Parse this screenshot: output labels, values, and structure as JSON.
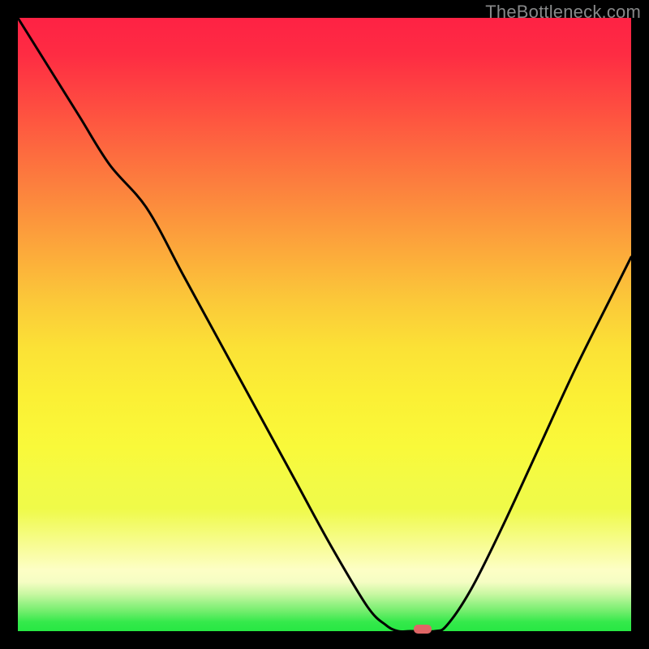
{
  "watermark": "TheBottleneck.com",
  "colors": {
    "gradient_top": "#fe2244",
    "gradient_mid": "#fbe236",
    "gradient_bottom": "#27e743",
    "curve_stroke": "#000000",
    "marker_fill": "#e06666",
    "frame_bg": "#000000"
  },
  "chart_data": {
    "type": "line",
    "title": "",
    "xlabel": "",
    "ylabel": "",
    "xlim": [
      0,
      100
    ],
    "ylim": [
      0,
      100
    ],
    "grid": false,
    "legend": false,
    "annotations": [
      {
        "kind": "marker",
        "x": 66,
        "y": 0,
        "shape": "rounded-rect",
        "color": "#e06666"
      }
    ],
    "series": [
      {
        "name": "bottleneck-curve",
        "color": "#000000",
        "x": [
          0,
          5,
          10,
          15,
          21,
          27,
          33,
          39,
          45,
          51,
          57,
          60,
          62,
          64,
          68,
          70,
          74,
          79,
          85,
          91,
          97,
          100
        ],
        "y": [
          100,
          92,
          84,
          76,
          69,
          58,
          47,
          36,
          25,
          14,
          4,
          1,
          0,
          0,
          0,
          1,
          7,
          17,
          30,
          43,
          55,
          61
        ]
      }
    ]
  }
}
